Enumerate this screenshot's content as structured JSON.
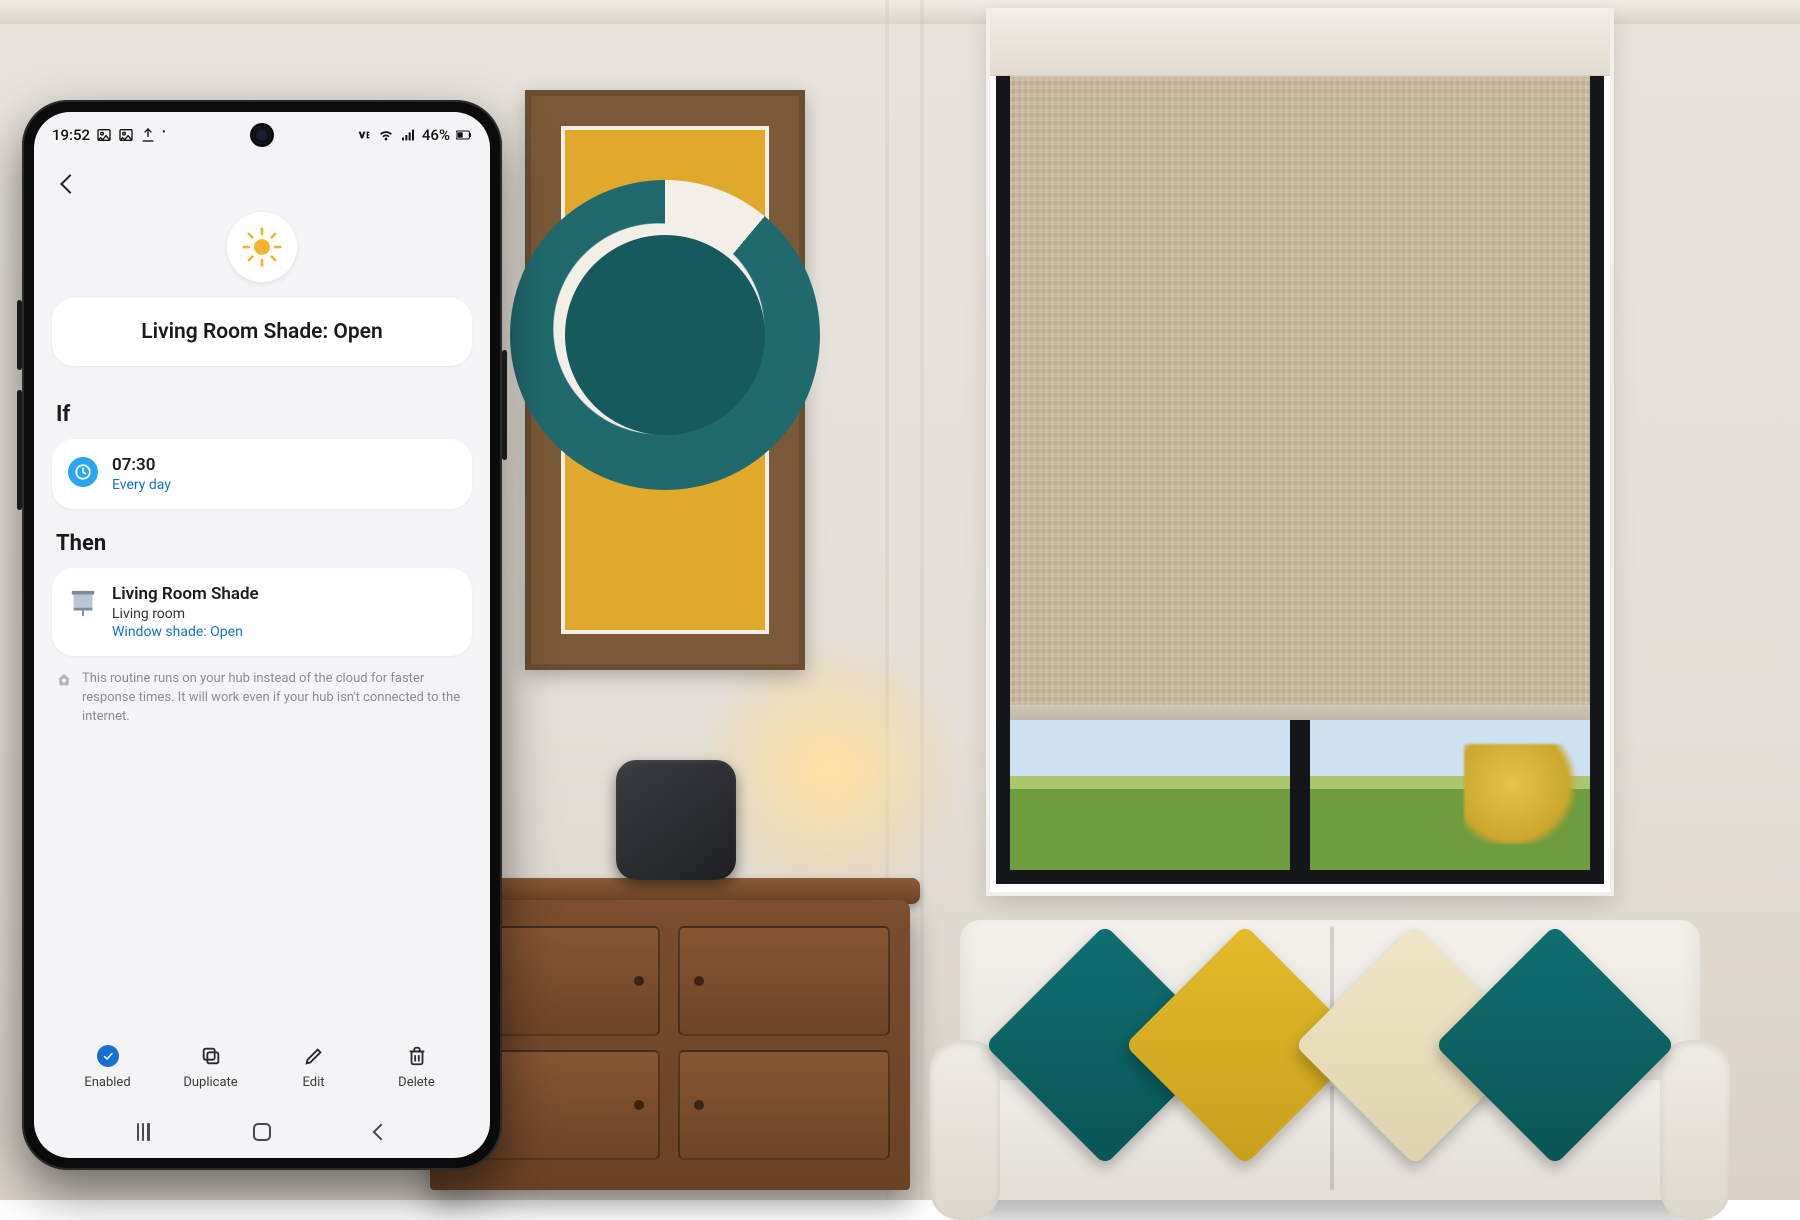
{
  "status_bar": {
    "time": "19:52",
    "battery_text": "46%",
    "left_icons": [
      "image-icon",
      "image-icon",
      "upload-icon"
    ],
    "right_icons": [
      "volte-icon",
      "wifi-icon",
      "signal-icon",
      "battery-icon"
    ]
  },
  "routine": {
    "title": "Living Room Shade: Open",
    "icon": "sun-icon"
  },
  "sections": {
    "if_label": "If",
    "then_label": "Then"
  },
  "if_card": {
    "time": "07:30",
    "repeat": "Every day",
    "icon": "clock-icon"
  },
  "then_card": {
    "device": "Living Room Shade",
    "room": "Living room",
    "action": "Window shade: Open",
    "icon": "window-shade-icon"
  },
  "info_note": "This routine runs on your hub instead of the cloud for faster response times. It will work even if your hub isn't connected to the internet.",
  "bottom_actions": {
    "enabled": "Enabled",
    "duplicate": "Duplicate",
    "edit": "Edit",
    "delete": "Delete"
  },
  "colors": {
    "accent_blue": "#1570d1",
    "clock_blue": "#2aa7f0"
  }
}
